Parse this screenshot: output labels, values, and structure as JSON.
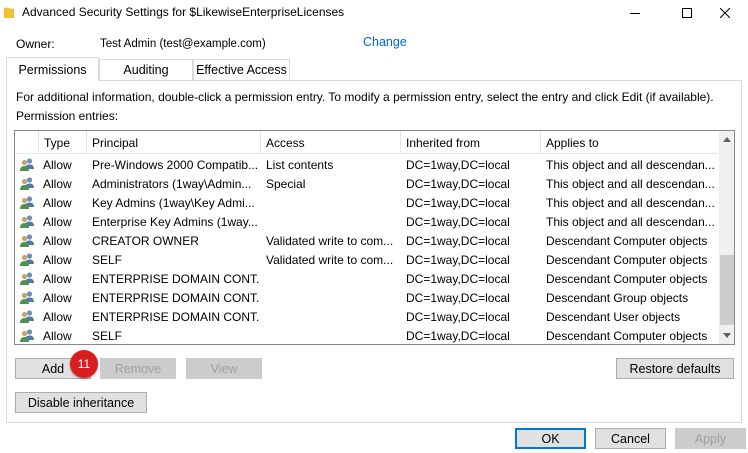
{
  "window": {
    "title": "Advanced Security Settings for $LikewiseEnterpriseLicenses"
  },
  "owner": {
    "label": "Owner:",
    "value": "Test Admin (test@example.com)",
    "change_label": "Change"
  },
  "tabs": [
    {
      "label": "Permissions",
      "active": true
    },
    {
      "label": "Auditing",
      "active": false
    },
    {
      "label": "Effective Access",
      "active": false
    }
  ],
  "info_text": "For additional information, double-click a permission entry. To modify a permission entry, select the entry and click Edit (if available).",
  "entries_label": "Permission entries:",
  "columns": [
    "Type",
    "Principal",
    "Access",
    "Inherited from",
    "Applies to"
  ],
  "entries": [
    {
      "type": "Allow",
      "principal": "Pre-Windows 2000 Compatib...",
      "access": "List contents",
      "inherited": "DC=1way,DC=local",
      "applies": "This object and all descendan..."
    },
    {
      "type": "Allow",
      "principal": "Administrators (1way\\Admin...",
      "access": "Special",
      "inherited": "DC=1way,DC=local",
      "applies": "This object and all descendan..."
    },
    {
      "type": "Allow",
      "principal": "Key Admins (1way\\Key Admi...",
      "access": "",
      "inherited": "DC=1way,DC=local",
      "applies": "This object and all descendan..."
    },
    {
      "type": "Allow",
      "principal": "Enterprise Key Admins (1way...",
      "access": "",
      "inherited": "DC=1way,DC=local",
      "applies": "This object and all descendan..."
    },
    {
      "type": "Allow",
      "principal": "CREATOR OWNER",
      "access": "Validated write to com...",
      "inherited": "DC=1way,DC=local",
      "applies": "Descendant Computer objects"
    },
    {
      "type": "Allow",
      "principal": "SELF",
      "access": "Validated write to com...",
      "inherited": "DC=1way,DC=local",
      "applies": "Descendant Computer objects"
    },
    {
      "type": "Allow",
      "principal": "ENTERPRISE DOMAIN CONT...",
      "access": "",
      "inherited": "DC=1way,DC=local",
      "applies": "Descendant Computer objects"
    },
    {
      "type": "Allow",
      "principal": "ENTERPRISE DOMAIN CONT...",
      "access": "",
      "inherited": "DC=1way,DC=local",
      "applies": "Descendant Group objects"
    },
    {
      "type": "Allow",
      "principal": "ENTERPRISE DOMAIN CONT...",
      "access": "",
      "inherited": "DC=1way,DC=local",
      "applies": "Descendant User objects"
    },
    {
      "type": "Allow",
      "principal": "SELF",
      "access": "",
      "inherited": "DC=1way,DC=local",
      "applies": "Descendant Computer objects"
    }
  ],
  "buttons": {
    "add": "Add",
    "remove": "Remove",
    "view": "View",
    "restore_defaults": "Restore defaults",
    "disable_inheritance": "Disable inheritance",
    "ok": "OK",
    "cancel": "Cancel",
    "apply": "Apply"
  },
  "step_badge": "11",
  "colors": {
    "link": "#0066cc",
    "badge": "#d81e1e",
    "default_button_border": "#0078d7"
  }
}
